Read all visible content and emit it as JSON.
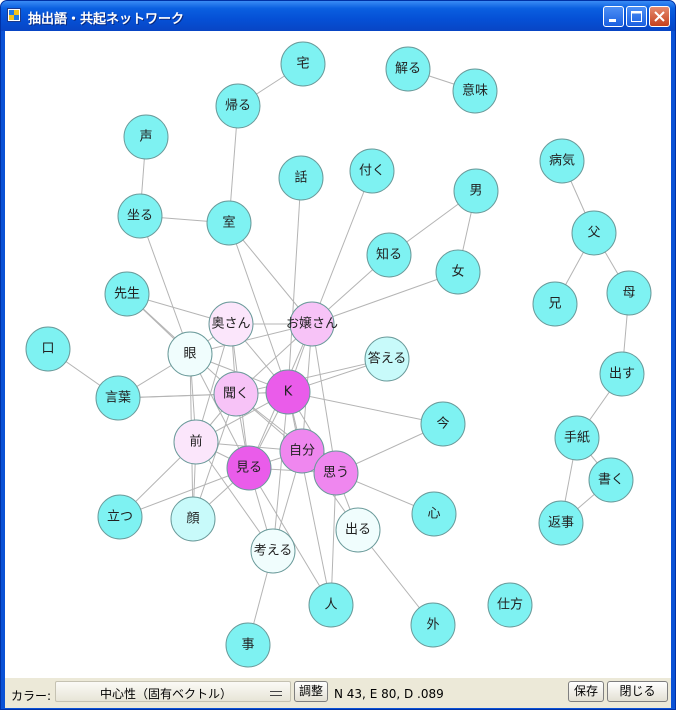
{
  "window": {
    "title": "抽出語・共起ネットワーク"
  },
  "toolbar": {
    "color_label": "カラー:",
    "color_select": "中心性（固有ベクトル）",
    "adjust_button": "調整",
    "stats": "N 43, E 80, D .089",
    "save_button": "保存",
    "close_button": "閉じる"
  },
  "colors": {
    "cyan": "#7ef2f2",
    "pale_cyan": "#c8fafa",
    "very_pale": "#f0fdfd",
    "light_pink": "#fbe6fb",
    "pink": "#f7c3f7",
    "magenta": "#ef87ef",
    "strong_magenta": "#ea5cea",
    "edge": "#b4b4b4"
  },
  "network": {
    "nodes": [
      {
        "label": "宅",
        "color": "cyan"
      },
      {
        "label": "解る",
        "color": "cyan"
      },
      {
        "label": "意味",
        "color": "cyan"
      },
      {
        "label": "帰る",
        "color": "cyan"
      },
      {
        "label": "声",
        "color": "cyan"
      },
      {
        "label": "病気",
        "color": "cyan"
      },
      {
        "label": "話",
        "color": "cyan"
      },
      {
        "label": "付く",
        "color": "cyan"
      },
      {
        "label": "男",
        "color": "cyan"
      },
      {
        "label": "坐る",
        "color": "cyan"
      },
      {
        "label": "室",
        "color": "cyan"
      },
      {
        "label": "父",
        "color": "cyan"
      },
      {
        "label": "知る",
        "color": "cyan"
      },
      {
        "label": "女",
        "color": "cyan"
      },
      {
        "label": "先生",
        "color": "cyan"
      },
      {
        "label": "母",
        "color": "cyan"
      },
      {
        "label": "兄",
        "color": "cyan"
      },
      {
        "label": "奥さん",
        "color": "light_pink"
      },
      {
        "label": "お嬢さん",
        "color": "pink"
      },
      {
        "label": "口",
        "color": "cyan"
      },
      {
        "label": "眼",
        "color": "very_pale"
      },
      {
        "label": "答える",
        "color": "pale_cyan"
      },
      {
        "label": "出す",
        "color": "cyan"
      },
      {
        "label": "言葉",
        "color": "cyan"
      },
      {
        "label": "聞く",
        "color": "pink"
      },
      {
        "label": "K",
        "color": "strong_magenta"
      },
      {
        "label": "今",
        "color": "cyan"
      },
      {
        "label": "手紙",
        "color": "cyan"
      },
      {
        "label": "前",
        "color": "light_pink"
      },
      {
        "label": "自分",
        "color": "magenta"
      },
      {
        "label": "見る",
        "color": "strong_magenta"
      },
      {
        "label": "思う",
        "color": "magenta"
      },
      {
        "label": "書く",
        "color": "cyan"
      },
      {
        "label": "立つ",
        "color": "cyan"
      },
      {
        "label": "顔",
        "color": "pale_cyan"
      },
      {
        "label": "心",
        "color": "cyan"
      },
      {
        "label": "出る",
        "color": "very_pale"
      },
      {
        "label": "返事",
        "color": "cyan"
      },
      {
        "label": "考える",
        "color": "very_pale"
      },
      {
        "label": "仕方",
        "color": "cyan"
      },
      {
        "label": "人",
        "color": "cyan"
      },
      {
        "label": "外",
        "color": "cyan"
      },
      {
        "label": "事",
        "color": "cyan"
      }
    ],
    "edges": [
      [
        "宅",
        "帰る"
      ],
      [
        "帰る",
        "室"
      ],
      [
        "解る",
        "意味"
      ],
      [
        "声",
        "坐る"
      ],
      [
        "坐る",
        "室"
      ],
      [
        "坐る",
        "眼"
      ],
      [
        "室",
        "K"
      ],
      [
        "室",
        "お嬢さん"
      ],
      [
        "話",
        "K"
      ],
      [
        "付く",
        "お嬢さん"
      ],
      [
        "男",
        "知る"
      ],
      [
        "男",
        "女"
      ],
      [
        "知る",
        "お嬢さん"
      ],
      [
        "女",
        "お嬢さん"
      ],
      [
        "病気",
        "父"
      ],
      [
        "父",
        "兄"
      ],
      [
        "父",
        "母"
      ],
      [
        "母",
        "出す"
      ],
      [
        "出す",
        "手紙"
      ],
      [
        "手紙",
        "書く"
      ],
      [
        "手紙",
        "返事"
      ],
      [
        "書く",
        "返事"
      ],
      [
        "先生",
        "奥さん"
      ],
      [
        "先生",
        "眼"
      ],
      [
        "先生",
        "聞く"
      ],
      [
        "口",
        "言葉"
      ],
      [
        "言葉",
        "眼"
      ],
      [
        "言葉",
        "聞く"
      ],
      [
        "言葉",
        "K"
      ],
      [
        "奥さん",
        "眼"
      ],
      [
        "奥さん",
        "聞く"
      ],
      [
        "奥さん",
        "K"
      ],
      [
        "奥さん",
        "お嬢さん"
      ],
      [
        "奥さん",
        "前"
      ],
      [
        "奥さん",
        "見る"
      ],
      [
        "お嬢さん",
        "眼"
      ],
      [
        "お嬢さん",
        "聞く"
      ],
      [
        "お嬢さん",
        "K"
      ],
      [
        "お嬢さん",
        "自分"
      ],
      [
        "お嬢さん",
        "見る"
      ],
      [
        "お嬢さん",
        "思う"
      ],
      [
        "答える",
        "K"
      ],
      [
        "答える",
        "聞く"
      ],
      [
        "眼",
        "前"
      ],
      [
        "眼",
        "顔"
      ],
      [
        "眼",
        "K"
      ],
      [
        "眼",
        "見る"
      ],
      [
        "聞く",
        "K"
      ],
      [
        "聞く",
        "前"
      ],
      [
        "聞く",
        "自分"
      ],
      [
        "聞く",
        "見る"
      ],
      [
        "聞く",
        "思う"
      ],
      [
        "聞く",
        "顔"
      ],
      [
        "K",
        "自分"
      ],
      [
        "K",
        "見る"
      ],
      [
        "K",
        "思う"
      ],
      [
        "K",
        "今"
      ],
      [
        "K",
        "前"
      ],
      [
        "K",
        "考える"
      ],
      [
        "K",
        "人"
      ],
      [
        "前",
        "見る"
      ],
      [
        "前",
        "自分"
      ],
      [
        "前",
        "立つ"
      ],
      [
        "前",
        "顔"
      ],
      [
        "前",
        "考える"
      ],
      [
        "自分",
        "見る"
      ],
      [
        "自分",
        "思う"
      ],
      [
        "自分",
        "出る"
      ],
      [
        "自分",
        "考える"
      ],
      [
        "見る",
        "思う"
      ],
      [
        "見る",
        "立つ"
      ],
      [
        "見る",
        "顔"
      ],
      [
        "見る",
        "考える"
      ],
      [
        "見る",
        "人"
      ],
      [
        "思う",
        "今"
      ],
      [
        "思う",
        "心"
      ],
      [
        "思う",
        "出る"
      ],
      [
        "思う",
        "人"
      ],
      [
        "出る",
        "外"
      ],
      [
        "考える",
        "事"
      ]
    ]
  }
}
